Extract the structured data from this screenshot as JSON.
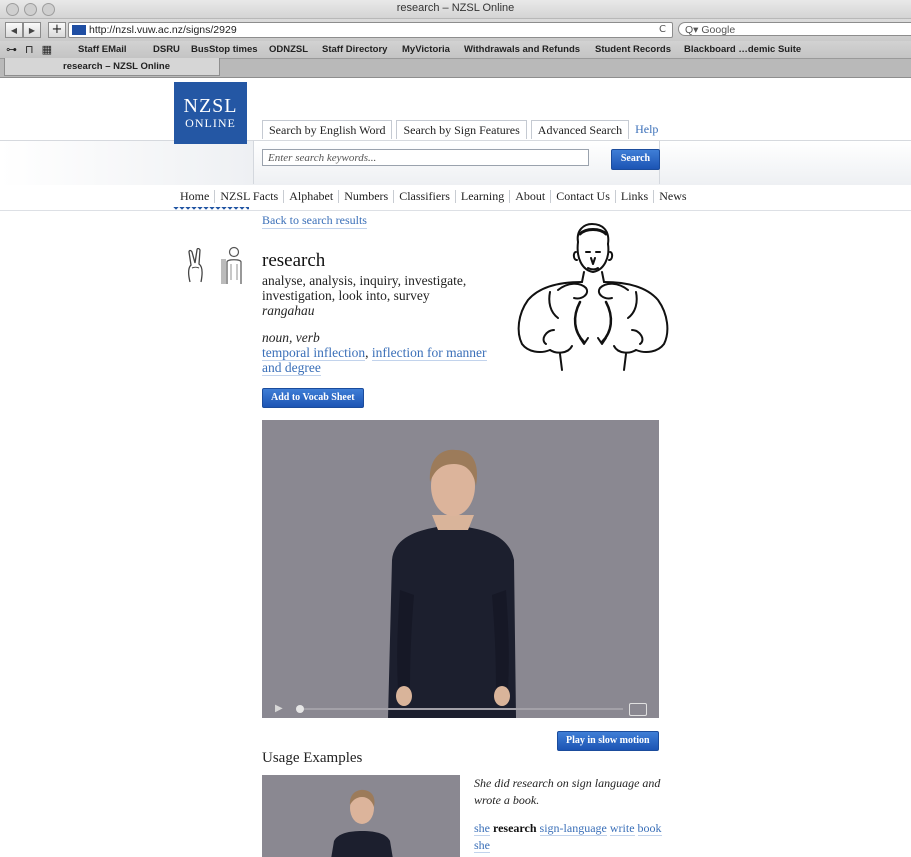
{
  "browser": {
    "window_title": "research – NZSL Online",
    "url": "http://nzsl.vuw.ac.nz/signs/2929",
    "search_placeholder": "Q▾ Google",
    "reload_glyph": "C",
    "bookmarks": [
      "Staff EMail",
      "DSRU",
      "BusStop times",
      "ODNZSL",
      "Staff Directory",
      "MyVictoria",
      "Withdrawals and Refunds",
      "Student Records",
      "Blackboard …demic Suite"
    ],
    "tab_title": "research – NZSL Online"
  },
  "site": {
    "logo_line1": "NZSL",
    "logo_line2": "ONLINE",
    "search_tabs": [
      "Search by English Word",
      "Search by Sign Features",
      "Advanced Search"
    ],
    "help": "Help",
    "search_placeholder": "Enter search keywords...",
    "search_button": "Search",
    "nav": [
      "Home",
      "NZSL Facts",
      "Alphabet",
      "Numbers",
      "Classifiers",
      "Learning",
      "About",
      "Contact Us",
      "Links",
      "News"
    ]
  },
  "entry": {
    "back_link": "Back to search results",
    "headword": "research",
    "synonyms": "analyse, analysis, inquiry, investigate, investigation, look into, survey",
    "maori": "rangahau",
    "pos": "noun, verb",
    "inflection_1": "temporal inflection",
    "inflection_sep": ", ",
    "inflection_2": "inflection for manner and degree",
    "vocab_button": "Add to Vocab Sheet",
    "slow_button": "Play in slow motion"
  },
  "usage": {
    "heading": "Usage Examples",
    "sentence": "She did research on sign language and wrote a book.",
    "gloss_1": "she",
    "gloss_2": "research",
    "gloss_3": "sign-language",
    "gloss_4": "write",
    "gloss_5": "book",
    "gloss_6": "she"
  },
  "colors": {
    "brand_blue": "#2457a4",
    "link": "#3a6fb8",
    "video_bg": "#8a8891",
    "presenter_dress": "#1c1f2e"
  }
}
